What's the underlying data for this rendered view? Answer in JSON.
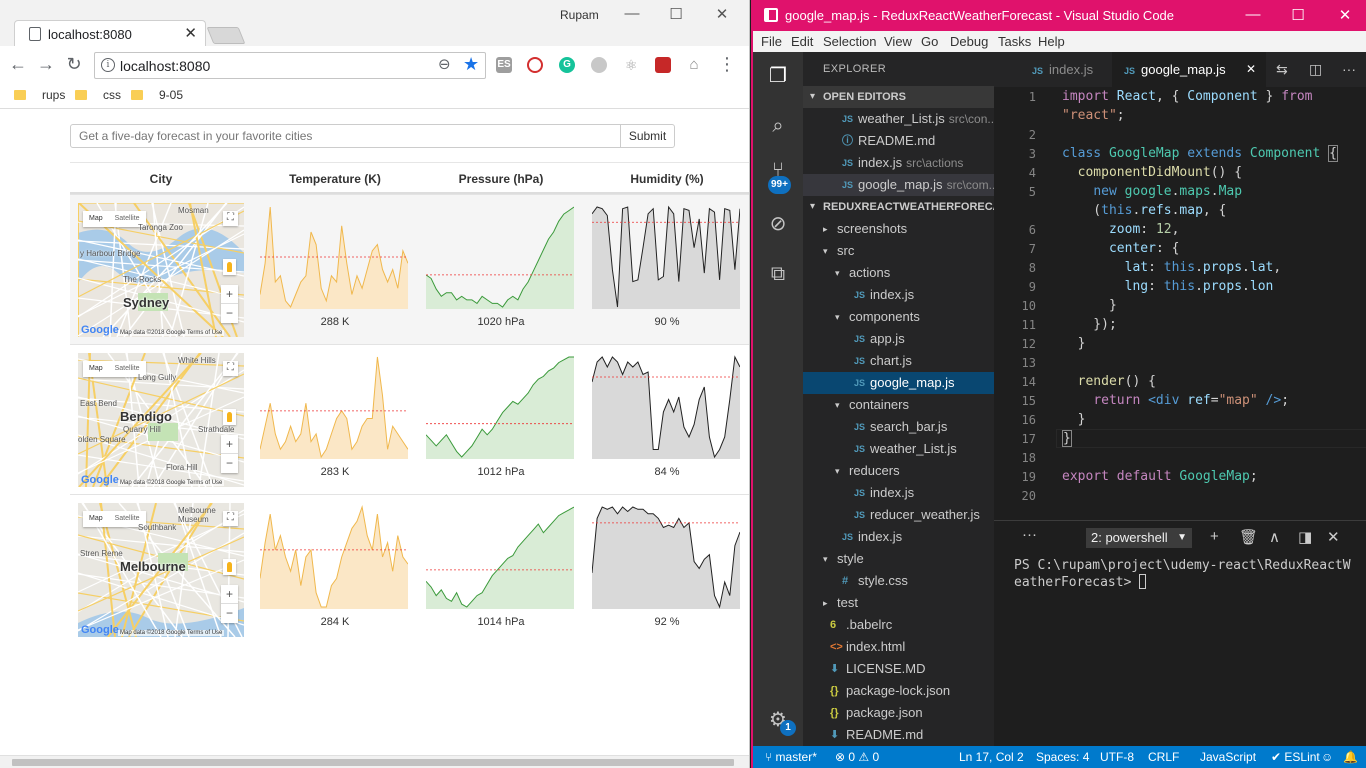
{
  "browser": {
    "tab_title": "localhost:8080",
    "profile": "Rupam",
    "url": "localhost:8080",
    "bookmarks": [
      "rups",
      "css",
      "9-05"
    ]
  },
  "page": {
    "search_placeholder": "Get a five-day forecast in your favorite cities",
    "submit_label": "Submit",
    "headers": [
      "City",
      "Temperature (K)",
      "Pressure (hPa)",
      "Humidity (%)"
    ],
    "rows": [
      {
        "map": {
          "city": "Sydney",
          "labels": [
            "Mosman",
            "Taronga Zoo",
            "y Harbour Bridge",
            "The Rocks"
          ],
          "toggle": [
            "Map",
            "Satellite"
          ],
          "attribution": "Map data ©2018 Google   Terms of Use"
        },
        "temperature": {
          "label": "288 K",
          "values": [
            282,
            287,
            296,
            284,
            285,
            281,
            280,
            282,
            284,
            285,
            292,
            290,
            283,
            281,
            285,
            284,
            293,
            287,
            282,
            285,
            283,
            286,
            289,
            290,
            286,
            284,
            286,
            283,
            289,
            287
          ],
          "avg": 288,
          "color": "#f0b84d",
          "fill": "#fbe7c6"
        },
        "pressure": {
          "label": "1020 hPa",
          "values": [
            1020,
            1019,
            1016,
            1014,
            1015,
            1015,
            1013,
            1014,
            1013,
            1013,
            1012,
            1014,
            1013,
            1012,
            1012,
            1011,
            1013,
            1014,
            1013,
            1016,
            1018,
            1021,
            1024,
            1027,
            1030,
            1032,
            1035,
            1037,
            1038,
            1039
          ],
          "avg": 1020,
          "color": "#3b9a3b",
          "fill": "#d9ecd6"
        },
        "humidity": {
          "label": "90 %",
          "values": [
            95,
            99,
            98,
            94,
            62,
            40,
            98,
            99,
            55,
            56,
            75,
            95,
            98,
            56,
            58,
            99,
            95,
            55,
            98,
            97,
            75,
            92,
            60,
            98,
            96,
            56,
            98,
            97,
            62,
            98
          ],
          "avg": 90,
          "color": "#222222",
          "fill": "#d9d9d9"
        }
      },
      {
        "map": {
          "city": "Bendigo",
          "labels": [
            "White Hills",
            "Long Gully",
            "East Bend",
            "Quarry Hill",
            "olden Square",
            "Strathdale",
            "Flora Hill"
          ],
          "toggle": [
            "Map",
            "Satellite"
          ],
          "attribution": "Map data ©2018 Google   Terms of Use"
        },
        "temperature": {
          "label": "283 K",
          "values": [
            278,
            281,
            284,
            280,
            278,
            279,
            281,
            279,
            280,
            284,
            279,
            280,
            277,
            278,
            280,
            282,
            283,
            282,
            278,
            279,
            281,
            282,
            282,
            290,
            285,
            278,
            281,
            280,
            279,
            278
          ],
          "avg": 283,
          "color": "#f0b84d",
          "fill": "#fbe7c6"
        },
        "pressure": {
          "label": "1012 hPa",
          "values": [
            1008,
            1006,
            1004,
            1006,
            1008,
            1005,
            1002,
            1000,
            1002,
            1004,
            1007,
            1010,
            1008,
            1010,
            1013,
            1016,
            1018,
            1020,
            1019,
            1021,
            1023,
            1026,
            1028,
            1029,
            1031,
            1032,
            1034,
            1035,
            1036,
            1036
          ],
          "avg": 1012,
          "color": "#3b9a3b",
          "fill": "#d9ecd6"
        },
        "humidity": {
          "label": "84 %",
          "values": [
            82,
            90,
            92,
            88,
            92,
            90,
            85,
            90,
            88,
            90,
            85,
            86,
            55,
            55,
            70,
            75,
            70,
            76,
            64,
            60,
            65,
            75,
            80,
            60,
            52,
            55,
            60,
            75,
            92,
            88
          ],
          "avg": 84,
          "color": "#222222",
          "fill": "#d9d9d9"
        }
      },
      {
        "map": {
          "city": "Melbourne",
          "labels": [
            "Melbourne Museum",
            "Southbank",
            "Stren Reme"
          ],
          "toggle": [
            "Map",
            "Satellite"
          ],
          "attribution": "Map data ©2018 Google   Terms of Use"
        },
        "temperature": {
          "label": "284 K",
          "values": [
            280,
            285,
            289,
            284,
            286,
            283,
            281,
            284,
            279,
            283,
            284,
            278,
            276,
            276,
            279,
            280,
            283,
            285,
            287,
            288,
            290,
            286,
            284,
            289,
            283,
            285,
            281,
            286,
            283,
            282
          ],
          "avg": 284,
          "color": "#f0b84d",
          "fill": "#fbe7c6"
        },
        "pressure": {
          "label": "1014 hPa",
          "values": [
            1010,
            1008,
            1005,
            1007,
            1004,
            1003,
            1006,
            1002,
            1001,
            1003,
            1005,
            1006,
            1009,
            1012,
            1014,
            1016,
            1018,
            1019,
            1022,
            1024,
            1026,
            1028,
            1030,
            1027,
            1029,
            1031,
            1033,
            1034,
            1035,
            1036
          ],
          "avg": 1014,
          "color": "#3b9a3b",
          "fill": "#d9ecd6"
        },
        "humidity": {
          "label": "92 %",
          "values": [
            70,
            94,
            99,
            98,
            99,
            96,
            99,
            97,
            99,
            98,
            98,
            96,
            96,
            94,
            90,
            91,
            90,
            94,
            90,
            92,
            75,
            72,
            76,
            78,
            60,
            55,
            66,
            60,
            82,
            88
          ],
          "avg": 92,
          "color": "#222222",
          "fill": "#d9d9d9"
        }
      }
    ]
  },
  "vscode": {
    "window_title": "google_map.js - ReduxReactWeatherForecast - Visual Studio Code",
    "menu": [
      "File",
      "Edit",
      "Selection",
      "View",
      "Go",
      "Debug",
      "Tasks",
      "Help"
    ],
    "explorer_title": "EXPLORER",
    "open_editors_label": "OPEN EDITORS",
    "open_editors": [
      {
        "name": "weather_List.js",
        "desc": "src\\con..."
      },
      {
        "name": "README.md",
        "desc": ""
      },
      {
        "name": "index.js",
        "desc": "src\\actions"
      },
      {
        "name": "google_map.js",
        "desc": "src\\com..."
      }
    ],
    "project_label": "REDUXREACTWEATHERFORECA...",
    "tree": [
      {
        "name": "screenshots",
        "kind": "folder-closed",
        "depth": 1
      },
      {
        "name": "src",
        "kind": "folder-open",
        "depth": 1
      },
      {
        "name": "actions",
        "kind": "folder-open",
        "depth": 2
      },
      {
        "name": "index.js",
        "kind": "js",
        "depth": 3
      },
      {
        "name": "components",
        "kind": "folder-open",
        "depth": 2
      },
      {
        "name": "app.js",
        "kind": "js",
        "depth": 3
      },
      {
        "name": "chart.js",
        "kind": "js",
        "depth": 3
      },
      {
        "name": "google_map.js",
        "kind": "js",
        "depth": 3
      },
      {
        "name": "containers",
        "kind": "folder-open",
        "depth": 2
      },
      {
        "name": "search_bar.js",
        "kind": "js",
        "depth": 3
      },
      {
        "name": "weather_List.js",
        "kind": "js",
        "depth": 3
      },
      {
        "name": "reducers",
        "kind": "folder-open",
        "depth": 2
      },
      {
        "name": "index.js",
        "kind": "js",
        "depth": 3
      },
      {
        "name": "reducer_weather.js",
        "kind": "js",
        "depth": 3
      },
      {
        "name": "index.js",
        "kind": "js",
        "depth": 2
      },
      {
        "name": "style",
        "kind": "folder-open",
        "depth": 1
      },
      {
        "name": "style.css",
        "kind": "css",
        "depth": 2
      },
      {
        "name": "test",
        "kind": "folder-closed",
        "depth": 1
      },
      {
        "name": ".babelrc",
        "kind": "babel",
        "depth": 1
      },
      {
        "name": "index.html",
        "kind": "html",
        "depth": 1
      },
      {
        "name": "LICENSE.MD",
        "kind": "md",
        "depth": 1
      },
      {
        "name": "package-lock.json",
        "kind": "json",
        "depth": 1
      },
      {
        "name": "package.json",
        "kind": "json",
        "depth": 1
      },
      {
        "name": "README.md",
        "kind": "md",
        "depth": 1
      }
    ],
    "editor_tabs": [
      {
        "name": "index.js",
        "active": false
      },
      {
        "name": "google_map.js",
        "active": true
      }
    ],
    "code_lines": [
      {
        "no": "1",
        "html": "<span class=\"kw2\">import</span> <span class=\"va\">React</span>, { <span class=\"va\">Component</span> } <span class=\"kw2\">from</span>"
      },
      {
        "no": "",
        "html": "<span class=\"st\">\"react\"</span>;"
      },
      {
        "no": "2",
        "html": ""
      },
      {
        "no": "3",
        "html": "<span class=\"kw\">class</span> <span class=\"ty\">GoogleMap</span> <span class=\"kw\">extends</span> <span class=\"ty\">Component</span> <span class=\"br\">{</span>"
      },
      {
        "no": "4",
        "html": "  <span class=\"fn\">componentDidMount</span>() {"
      },
      {
        "no": "5",
        "html": "    <span class=\"kw\">new</span> <span class=\"ty\">google</span>.<span class=\"ty\">maps</span>.<span class=\"ty\">Map</span>"
      },
      {
        "no": "",
        "html": "    (<span class=\"kw\">this</span>.<span class=\"va\">refs</span>.<span class=\"va\">map</span>, {"
      },
      {
        "no": "6",
        "html": "      <span class=\"va\">zoom</span>: <span class=\"nu\">12</span>,"
      },
      {
        "no": "7",
        "html": "      <span class=\"va\">center</span>: {"
      },
      {
        "no": "8",
        "html": "        <span class=\"va\">lat</span>: <span class=\"kw\">this</span>.<span class=\"va\">props</span>.<span class=\"va\">lat</span>,"
      },
      {
        "no": "9",
        "html": "        <span class=\"va\">lng</span>: <span class=\"kw\">this</span>.<span class=\"va\">props</span>.<span class=\"va\">lon</span>"
      },
      {
        "no": "10",
        "html": "      }"
      },
      {
        "no": "11",
        "html": "    });"
      },
      {
        "no": "12",
        "html": "  }"
      },
      {
        "no": "13",
        "html": ""
      },
      {
        "no": "14",
        "html": "  <span class=\"fn\">render</span>() {"
      },
      {
        "no": "15",
        "html": "    <span class=\"kw2\">return</span> <span class=\"kw\">&lt;div</span> <span class=\"va\">ref</span>=<span class=\"st\">\"map\"</span> <span class=\"kw\">/&gt;</span>;"
      },
      {
        "no": "16",
        "html": "  }"
      },
      {
        "no": "17",
        "html": "<span class=\"br\">}</span>"
      },
      {
        "no": "18",
        "html": ""
      },
      {
        "no": "19",
        "html": "<span class=\"kw2\">export</span> <span class=\"kw2\">default</span> <span class=\"ty\">GoogleMap</span>;"
      },
      {
        "no": "20",
        "html": ""
      }
    ],
    "terminal_select": "2: powershell",
    "terminal_text": "PS C:\\rupam\\project\\udemy-react\\ReduxReactWeatherForecast> ",
    "scm_badge": "99+",
    "settings_badge": "1",
    "status": {
      "branch": "master*",
      "errors": "0",
      "warnings": "0",
      "position": "Ln 17, Col 2",
      "spaces": "Spaces: 4",
      "encoding": "UTF-8",
      "eol": "CRLF",
      "language": "JavaScript",
      "linter": "ESLint"
    },
    "colors": {
      "accent": "#e0126c",
      "statusbar": "#007acc"
    }
  }
}
